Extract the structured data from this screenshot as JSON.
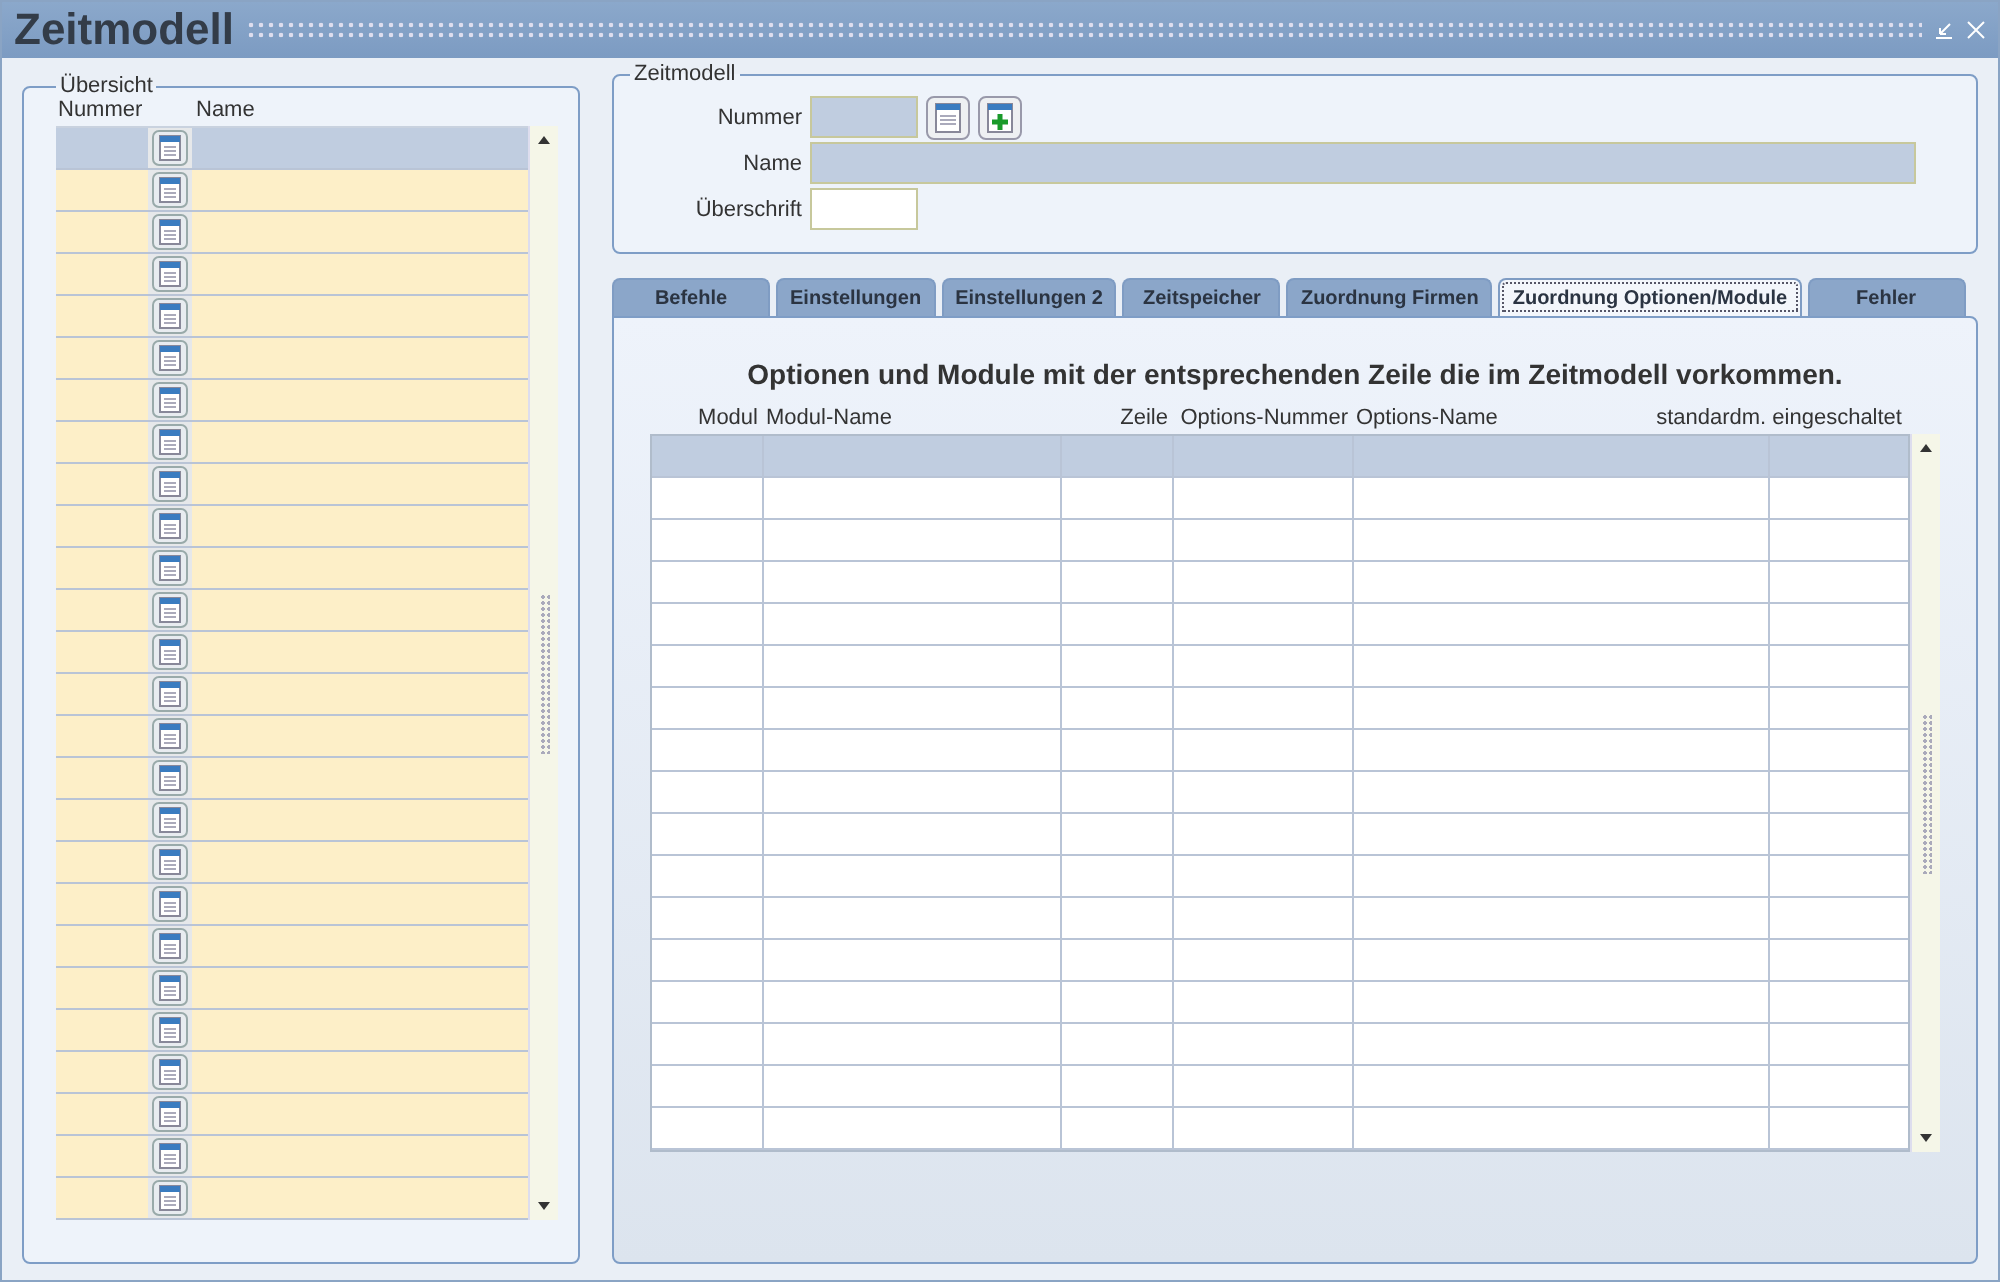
{
  "window": {
    "title": "Zeitmodell"
  },
  "overview": {
    "legend": "Übersicht",
    "columns": [
      "Nummer",
      "Name"
    ],
    "rows": [
      {
        "selected": true
      },
      {
        "selected": false
      },
      {
        "selected": false
      },
      {
        "selected": false
      },
      {
        "selected": false
      },
      {
        "selected": false
      },
      {
        "selected": false
      },
      {
        "selected": false
      },
      {
        "selected": false
      },
      {
        "selected": false
      },
      {
        "selected": false
      },
      {
        "selected": false
      },
      {
        "selected": false
      },
      {
        "selected": false
      },
      {
        "selected": false
      },
      {
        "selected": false
      },
      {
        "selected": false
      },
      {
        "selected": false
      },
      {
        "selected": false
      },
      {
        "selected": false
      },
      {
        "selected": false
      },
      {
        "selected": false
      },
      {
        "selected": false
      },
      {
        "selected": false
      },
      {
        "selected": false
      },
      {
        "selected": false
      }
    ]
  },
  "zeitmodell": {
    "legend": "Zeitmodell",
    "fields": [
      {
        "label": "Nummer",
        "kind": "short",
        "disabled": true
      },
      {
        "label": "Name",
        "kind": "long",
        "disabled": true
      },
      {
        "label": "Überschrift",
        "kind": "short",
        "disabled": false
      }
    ]
  },
  "tabs": [
    {
      "label": "Befehle",
      "selected": false
    },
    {
      "label": "Einstellungen",
      "selected": false
    },
    {
      "label": "Einstellungen 2",
      "selected": false
    },
    {
      "label": "Zeitspeicher",
      "selected": false
    },
    {
      "label": "Zuordnung Firmen",
      "selected": false
    },
    {
      "label": "Zuordnung Optionen/Module",
      "selected": true
    },
    {
      "label": "Fehler",
      "selected": false
    }
  ],
  "panel": {
    "heading": "Optionen und Module mit der entsprechenden Zeile die im Zeitmodell vorkommen.",
    "columns": [
      "Modul",
      "Modul-Name",
      "Zeile",
      "Options-Nummer",
      "Options-Name",
      "standardm. eingeschaltet"
    ],
    "rows": [
      {
        "selected": true
      },
      {
        "selected": false
      },
      {
        "selected": false
      },
      {
        "selected": false
      },
      {
        "selected": false
      },
      {
        "selected": false
      },
      {
        "selected": false
      },
      {
        "selected": false
      },
      {
        "selected": false
      },
      {
        "selected": false
      },
      {
        "selected": false
      },
      {
        "selected": false
      },
      {
        "selected": false
      },
      {
        "selected": false
      },
      {
        "selected": false
      },
      {
        "selected": false
      },
      {
        "selected": false
      }
    ]
  }
}
